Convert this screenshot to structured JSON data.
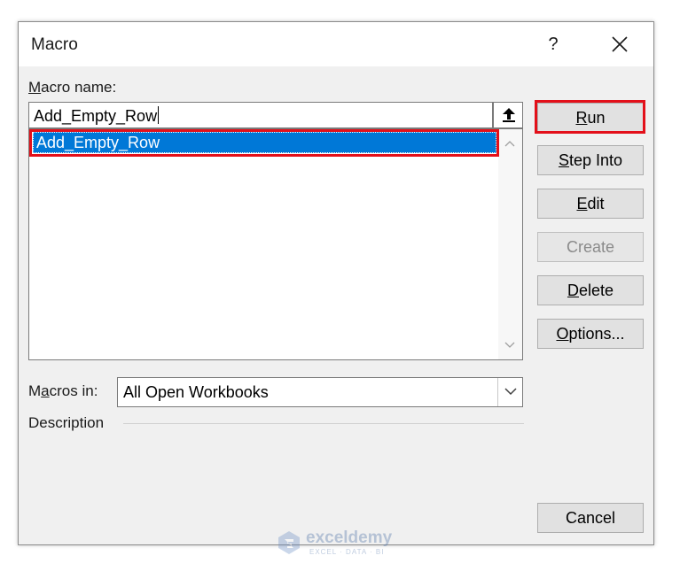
{
  "dialog": {
    "title": "Macro",
    "help_label": "?"
  },
  "macro_name": {
    "label_accel": "M",
    "label_rest": "acro name:",
    "value": "Add_Empty_Row"
  },
  "macro_list": {
    "items": [
      "Add_Empty_Row"
    ],
    "selected_index": 0
  },
  "buttons": {
    "run": {
      "accel": "R",
      "rest": "un"
    },
    "step_into": {
      "accel": "S",
      "rest": "tep Into"
    },
    "edit": {
      "accel": "E",
      "rest": "dit"
    },
    "create": {
      "label": "Create",
      "enabled": false
    },
    "delete": {
      "accel": "D",
      "rest": "elete"
    },
    "options": {
      "accel": "O",
      "rest": "ptions..."
    },
    "cancel": {
      "label": "Cancel"
    }
  },
  "macros_in": {
    "label_pre": "M",
    "label_accel": "a",
    "label_rest": "cros in:",
    "value": "All Open Workbooks"
  },
  "description": {
    "label": "Description"
  },
  "watermark": {
    "name": "exceldemy",
    "tagline": "EXCEL · DATA · BI"
  },
  "colors": {
    "highlight": "#e3101a",
    "selection": "#0078d7"
  },
  "icons": {
    "close": "close-icon",
    "upload": "arrow-up-icon",
    "scroll_up": "chevron-up-icon",
    "scroll_down": "chevron-down-icon",
    "dropdown": "chevron-down-icon"
  }
}
